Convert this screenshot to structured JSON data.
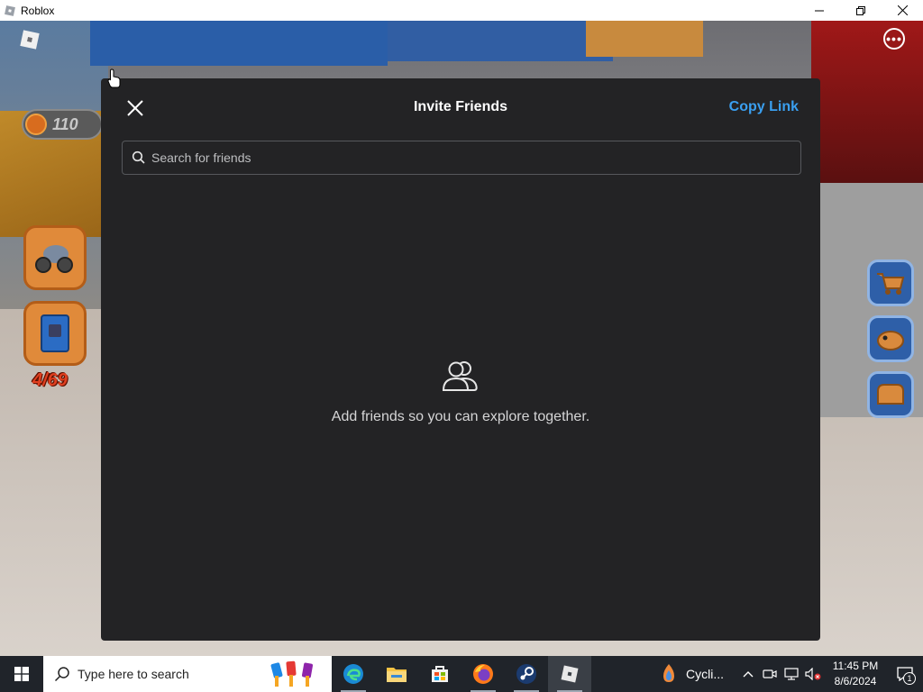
{
  "window": {
    "title": "Roblox",
    "controls": [
      "minimize-icon",
      "restore-icon",
      "close-icon"
    ]
  },
  "game": {
    "coins": "110",
    "collection_counter": "4/69",
    "left_buttons": [
      "vehicle-icon",
      "book-icon"
    ],
    "right_buttons": [
      "cart-icon",
      "pet-icon",
      "bread-icon"
    ]
  },
  "modal": {
    "title": "Invite Friends",
    "copy_link_label": "Copy Link",
    "search_placeholder": "Search for friends",
    "empty_message": "Add friends so you can explore together.",
    "accent_color": "#3a9ff0"
  },
  "taskbar": {
    "search_placeholder": "Type here to search",
    "pinned_apps": [
      "edge-icon",
      "file-explorer-icon",
      "store-icon",
      "firefox-icon",
      "steam-icon",
      "roblox-icon"
    ],
    "weather_label": "Cycli...",
    "time": "11:45 PM",
    "date": "8/6/2024",
    "notification_count": "1"
  }
}
